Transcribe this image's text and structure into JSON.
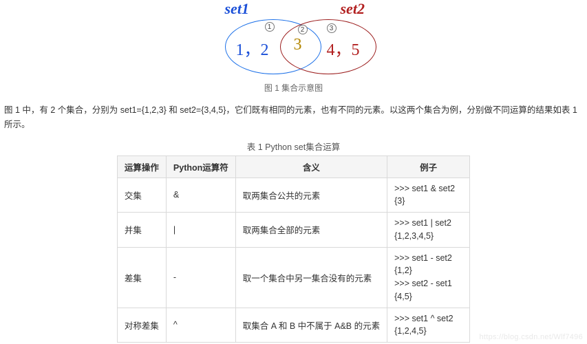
{
  "venn": {
    "label_set1": "set1",
    "label_set2": "set2",
    "region1": "1",
    "region2": "2",
    "region3": "3",
    "values_left": "1，2",
    "values_mid": "3",
    "values_right": "4，5"
  },
  "fig_caption": "图 1 集合示意图",
  "description": "图 1 中，有 2 个集合，分别为 set1={1,2,3} 和 set2={3,4,5}，它们既有相同的元素，也有不同的元素。以这两个集合为例，分别做不同运算的结果如表 1 所示。",
  "table_caption": "表 1 Python set集合运算",
  "table": {
    "headers": {
      "op": "运算操作",
      "sym": "Python运算符",
      "meaning": "含义",
      "example": "例子"
    },
    "rows": [
      {
        "op": "交集",
        "sym": "&",
        "meaning": "取两集合公共的元素",
        "example": ">>> set1 & set2\n{3}"
      },
      {
        "op": "并集",
        "sym": "|",
        "meaning": "取两集合全部的元素",
        "example": ">>> set1 | set2\n{1,2,3,4,5}"
      },
      {
        "op": "差集",
        "sym": "-",
        "meaning": "取一个集合中另一集合没有的元素",
        "example": ">>> set1 - set2\n{1,2}\n>>> set2 - set1\n{4,5}"
      },
      {
        "op": "对称差集",
        "sym": "^",
        "meaning": "取集合 A 和 B 中不属于 A&B 的元素",
        "example": ">>> set1 ^ set2\n{1,2,4,5}"
      }
    ]
  },
  "watermark": "https://blog.csdn.net/Wlf7496"
}
